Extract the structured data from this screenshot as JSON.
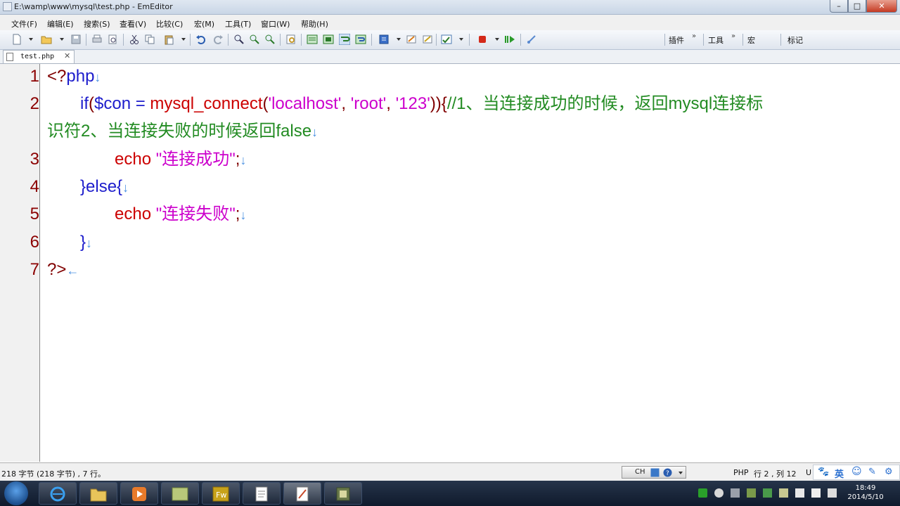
{
  "window": {
    "title": "E:\\wamp\\www\\mysql\\test.php - EmEditor",
    "min_label": "–",
    "max_label": "□",
    "close_label": "✕"
  },
  "menu": [
    "文件(F)",
    "编辑(E)",
    "搜索(S)",
    "查看(V)",
    "比较(C)",
    "宏(M)",
    "工具(T)",
    "窗口(W)",
    "帮助(H)"
  ],
  "toolbar_labels": {
    "plugins": "插件",
    "tools": "工具",
    "macro": "宏",
    "marks": "标记",
    "chevron": "»"
  },
  "tab": {
    "label": "test.php",
    "close": "✕"
  },
  "code": {
    "line_numbers": [
      "1",
      "2",
      "3",
      "4",
      "5",
      "6",
      "7"
    ],
    "l1": {
      "open": "<?",
      "php": "php"
    },
    "l2": {
      "if": "if",
      "lparen": "(",
      "var": "$con = ",
      "func": "mysql_connect",
      "lp2": "(",
      "s1": "'localhost'",
      "c1": ", ",
      "s2": "'root'",
      "c2": ", ",
      "s3": "'123'",
      "close": ")){",
      "comment_a": "//1、当连接成功的时候，返回mysql连接标",
      "comment_b": "识符2、当连接失败的时候返回false"
    },
    "l3": {
      "echo": "echo ",
      "str": "\"连接成功\"",
      "semi": ";"
    },
    "l4": {
      "text": "}else{"
    },
    "l5": {
      "echo": "echo ",
      "str": "\"连接失败\"",
      "semi": ";"
    },
    "l6": {
      "text": "}"
    },
    "l7": {
      "text": "?>"
    },
    "newline_mark": "↓",
    "eof_mark": "←"
  },
  "status": {
    "left": "218 字节 (218 字节) , 7 行。",
    "ime_text": "CH",
    "lang": "PHP",
    "position": "行 2 , 列 12",
    "encoding": "U"
  },
  "tray_top": [
    "🐾",
    "英",
    "☺",
    "✎",
    "⚙"
  ],
  "clock": {
    "time": "18:49",
    "date": "2014/5/10"
  },
  "colors": {
    "punct": "#800000",
    "keyword": "#1d1dcc",
    "function": "#cc0000",
    "string": "#cc00cc",
    "comment": "#228b22",
    "line_number": "#8b0000"
  }
}
